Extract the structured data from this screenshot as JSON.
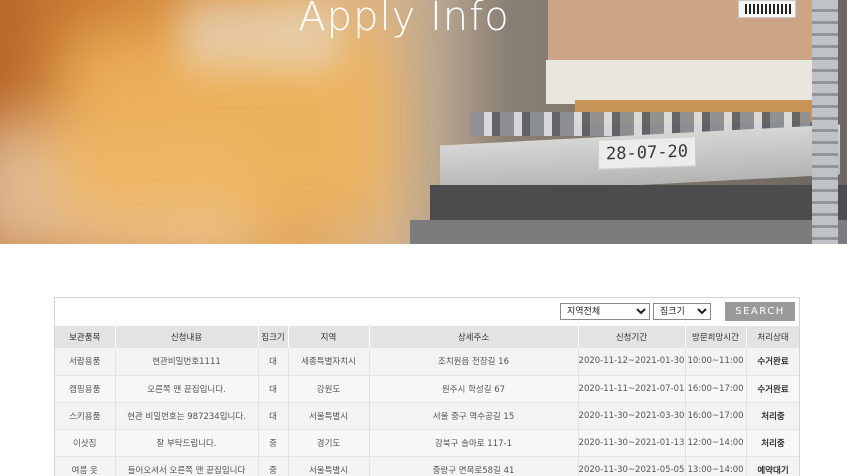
{
  "hero": {
    "title": "Apply Info",
    "shelf_label": "28-07-20"
  },
  "filters": {
    "region_selected": "지역전체",
    "size_selected": "짐크기",
    "search_label": "SEARCH"
  },
  "table": {
    "headers": [
      "보관품목",
      "신청내용",
      "짐크기",
      "지역",
      "상세주소",
      "신청기간",
      "방문희망시간",
      "처리상태"
    ],
    "rows": [
      [
        "서랍용품",
        "현관비밀번호1111",
        "대",
        "세종특별자치시",
        "조치원읍 전장길 16",
        "2020-11-12~2021-01-30",
        "10:00~11:00",
        "수거완료"
      ],
      [
        "캠핑용품",
        "오른쪽 맨 끝집입니다.",
        "대",
        "강원도",
        "원주시 학성길 67",
        "2020-11-11~2021-07-01",
        "16:00~17:00",
        "수거완료"
      ],
      [
        "스키용품",
        "현관 비밀번호는 987234입니다.",
        "대",
        "서울특별시",
        "서울 중구 역수공길 15",
        "2020-11-30~2021-03-30",
        "16:00~17:00",
        "처리중"
      ],
      [
        "이삿짐",
        "잘 부탁드립니다.",
        "중",
        "경기도",
        "강북구 솔마로 117-1",
        "2020-11-30~2021-01-13",
        "12:00~14:00",
        "처리중"
      ],
      [
        "여름 옷",
        "들어오셔서 오른쪽 맨 끝집입니다",
        "중",
        "서울특별시",
        "중랑구 면목로58길 41",
        "2020-11-30~2021-05-05",
        "13:00~14:00",
        "예약대기"
      ]
    ]
  }
}
